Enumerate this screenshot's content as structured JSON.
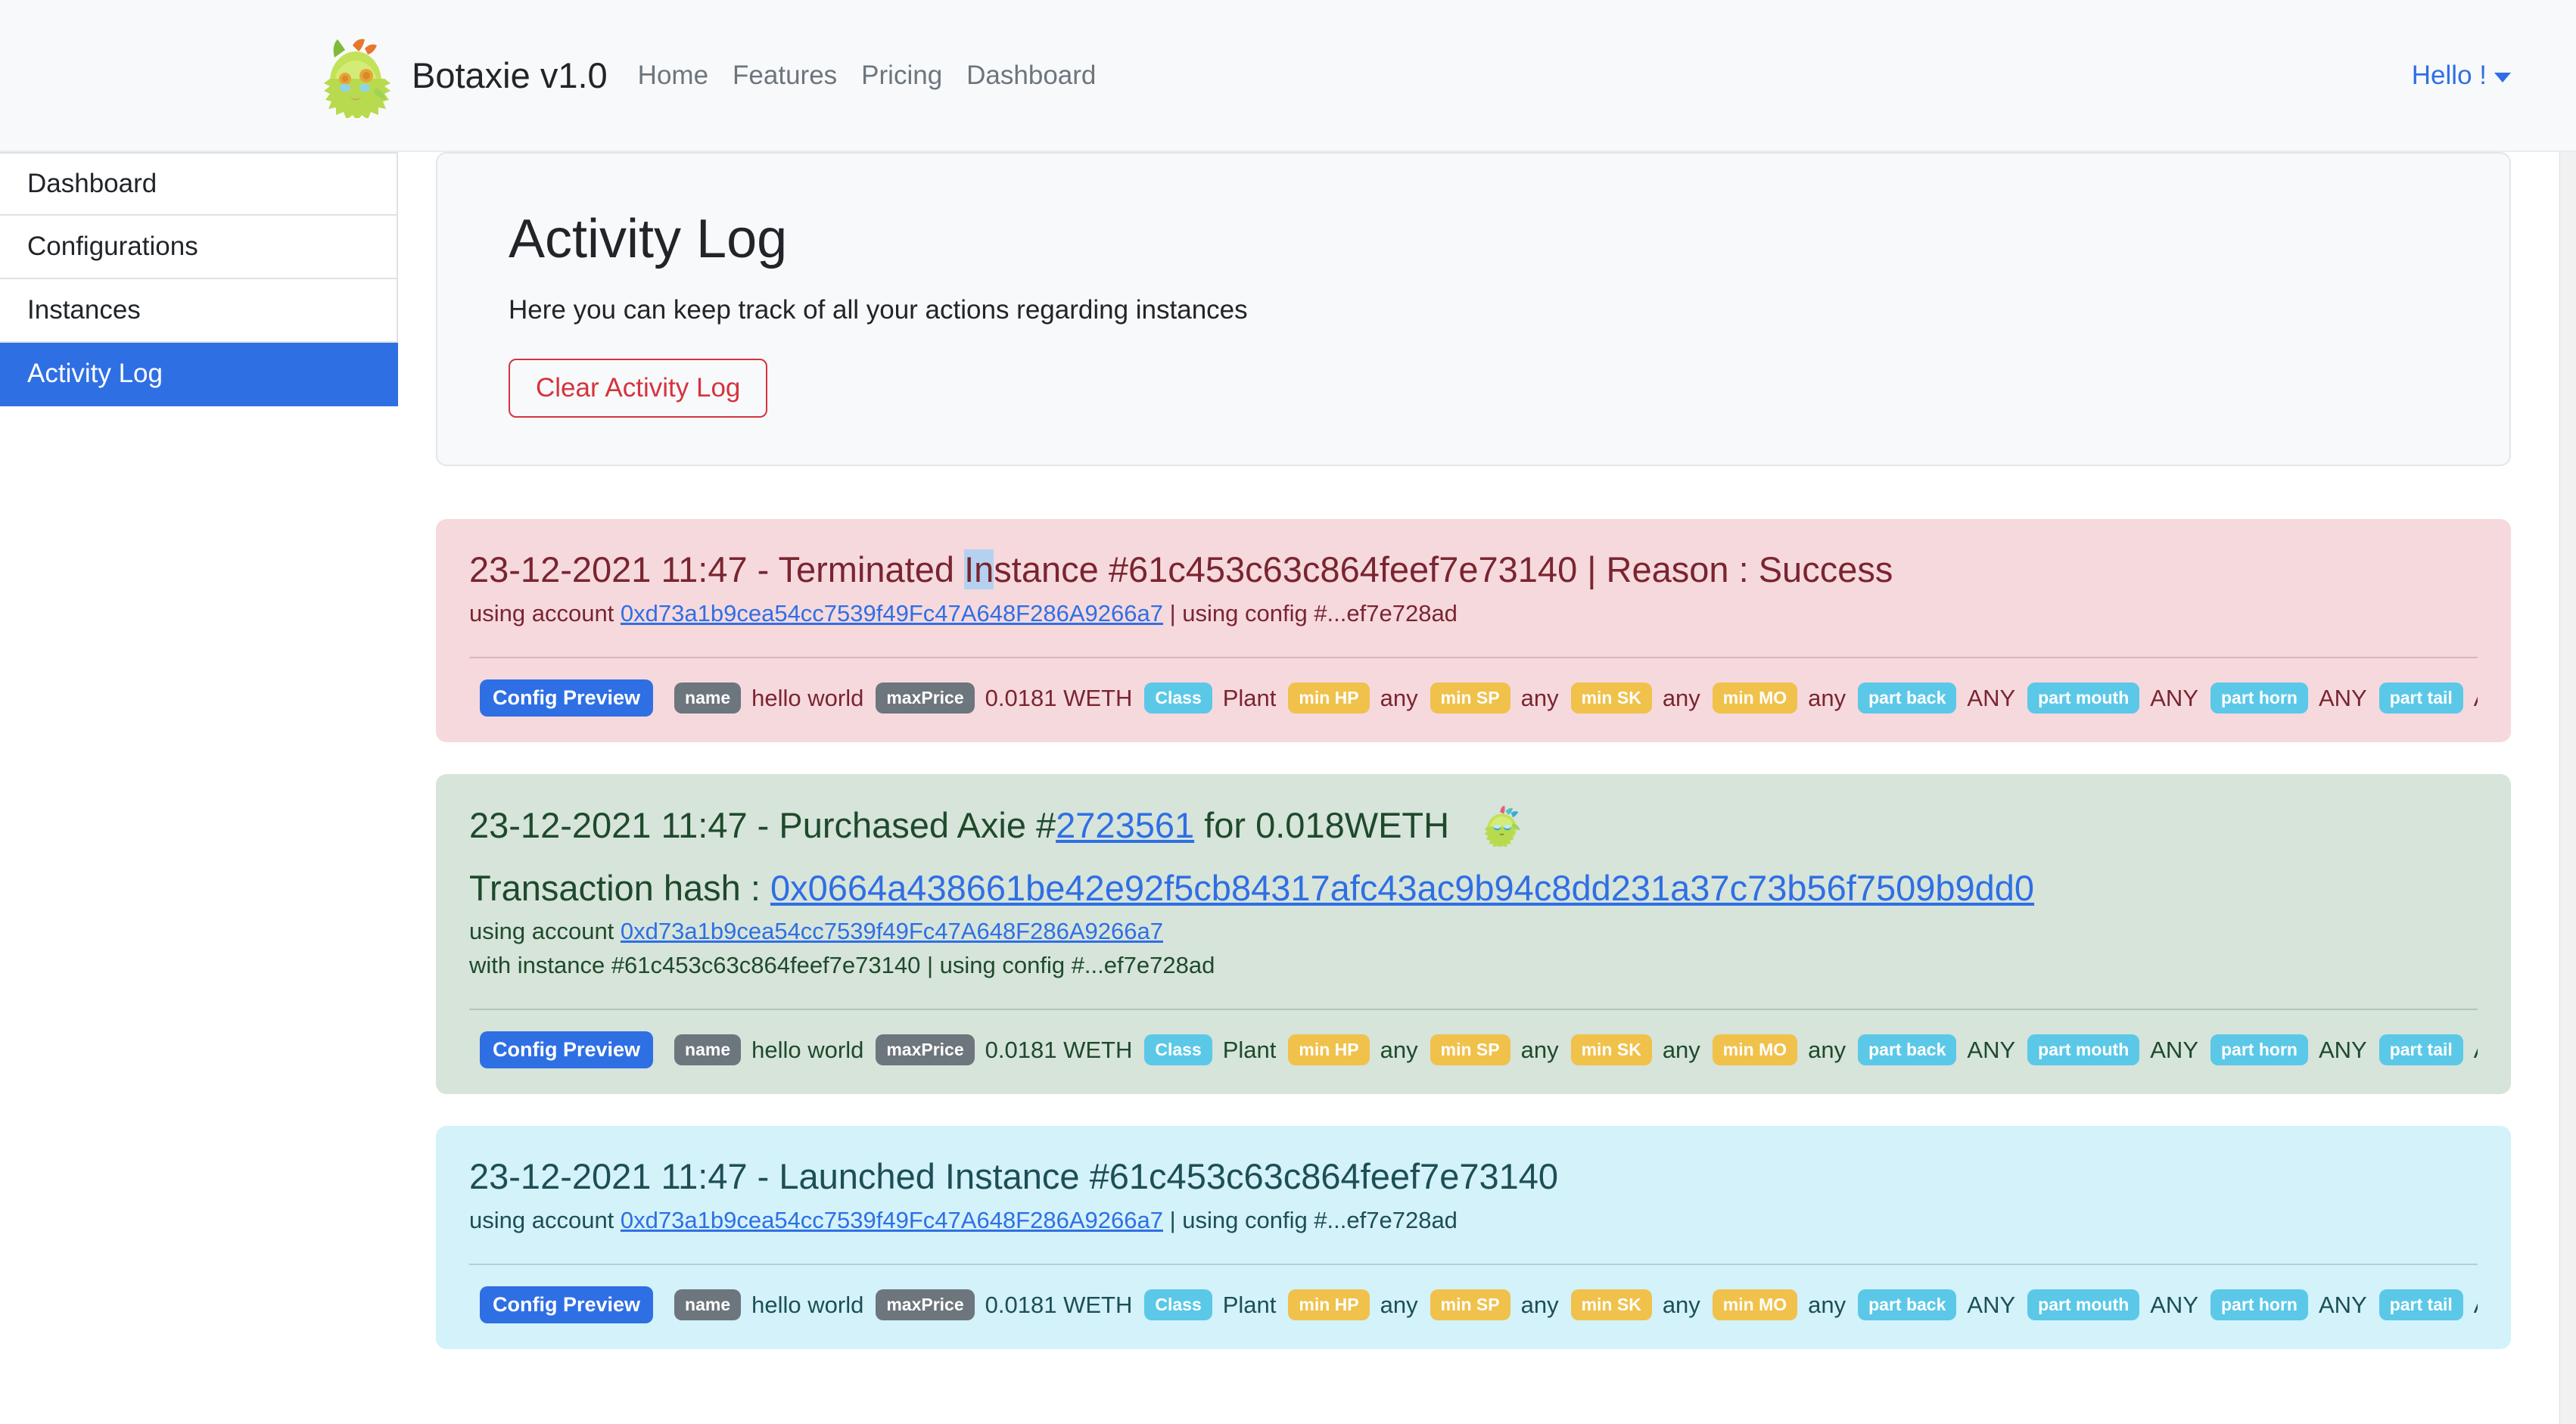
{
  "navbar": {
    "brand_title": "Botaxie v1.0",
    "logo_icon": "axie-creature-logo",
    "links": [
      "Home",
      "Features",
      "Pricing",
      "Dashboard"
    ],
    "user_menu": "Hello !",
    "caret_icon": "chevron-down-icon"
  },
  "sidebar": {
    "items": [
      {
        "label": "Dashboard",
        "active": false
      },
      {
        "label": "Configurations",
        "active": false
      },
      {
        "label": "Instances",
        "active": false
      },
      {
        "label": "Activity Log",
        "active": true
      }
    ]
  },
  "intro": {
    "title": "Activity Log",
    "subtitle": "Here you can keep track of all your actions regarding instances",
    "clear_button": "Clear Activity Log"
  },
  "colors": {
    "accent_blue": "#2f6fe4",
    "danger_red": "#d6333f",
    "danger_bg": "#f6d9dd",
    "danger_text": "#792530",
    "success_bg": "#d6e4da",
    "success_text": "#1e4a2b",
    "info_bg": "#d3f2f9",
    "info_text": "#1d4e56",
    "badge_gray": "#6d757d",
    "badge_cyan": "#5bc8e8",
    "badge_amber": "#f0c14b"
  },
  "config_preview": {
    "label": "Config Preview",
    "pairs": [
      {
        "key": "name",
        "style": "gray",
        "value": "hello world"
      },
      {
        "key": "maxPrice",
        "style": "gray",
        "value": "0.0181 WETH"
      },
      {
        "key": "Class",
        "style": "cyan",
        "value": "Plant"
      },
      {
        "key": "min HP",
        "style": "amber",
        "value": "any"
      },
      {
        "key": "min SP",
        "style": "amber",
        "value": "any"
      },
      {
        "key": "min SK",
        "style": "amber",
        "value": "any"
      },
      {
        "key": "min MO",
        "style": "amber",
        "value": "any"
      },
      {
        "key": "part back",
        "style": "cyan",
        "value": "ANY"
      },
      {
        "key": "part mouth",
        "style": "cyan",
        "value": "ANY"
      },
      {
        "key": "part horn",
        "style": "cyan",
        "value": "ANY"
      },
      {
        "key": "part tail",
        "style": "cyan",
        "value": "ANY"
      }
    ]
  },
  "logs": [
    {
      "type": "danger",
      "title_pre": "23-12-2021 11:47 - Terminated ",
      "title_sel": "In",
      "title_post": "stance #61c453c63c864feef7e73140 | Reason : Success",
      "sub_pre": "using account ",
      "account": "0xd73a1b9cea54cc7539f49Fc47A648F286A9266a7",
      "sub_post": " | using config #...ef7e728ad"
    },
    {
      "type": "success",
      "title_pre": "23-12-2021 11:47 - Purchased Axie #",
      "axie_id": "2723561",
      "title_post": " for 0.018WETH",
      "axie_icon": "axie-creature-icon",
      "title2_pre": "Transaction hash : ",
      "tx_hash": "0x0664a438661be42e92f5cb84317afc43ac9b94c8dd231a37c73b56f7509b9dd0",
      "sub_pre": "using account ",
      "account": "0xd73a1b9cea54cc7539f49Fc47A648F286A9266a7",
      "sub_line2": "with instance #61c453c63c864feef7e73140 | using config #...ef7e728ad"
    },
    {
      "type": "info",
      "title_pre": "23-12-2021 11:47 - Launched Instance #61c453c63c864feef7e73140",
      "sub_pre": "using account ",
      "account": "0xd73a1b9cea54cc7539f49Fc47A648F286A9266a7",
      "sub_post": " | using config #...ef7e728ad"
    }
  ]
}
